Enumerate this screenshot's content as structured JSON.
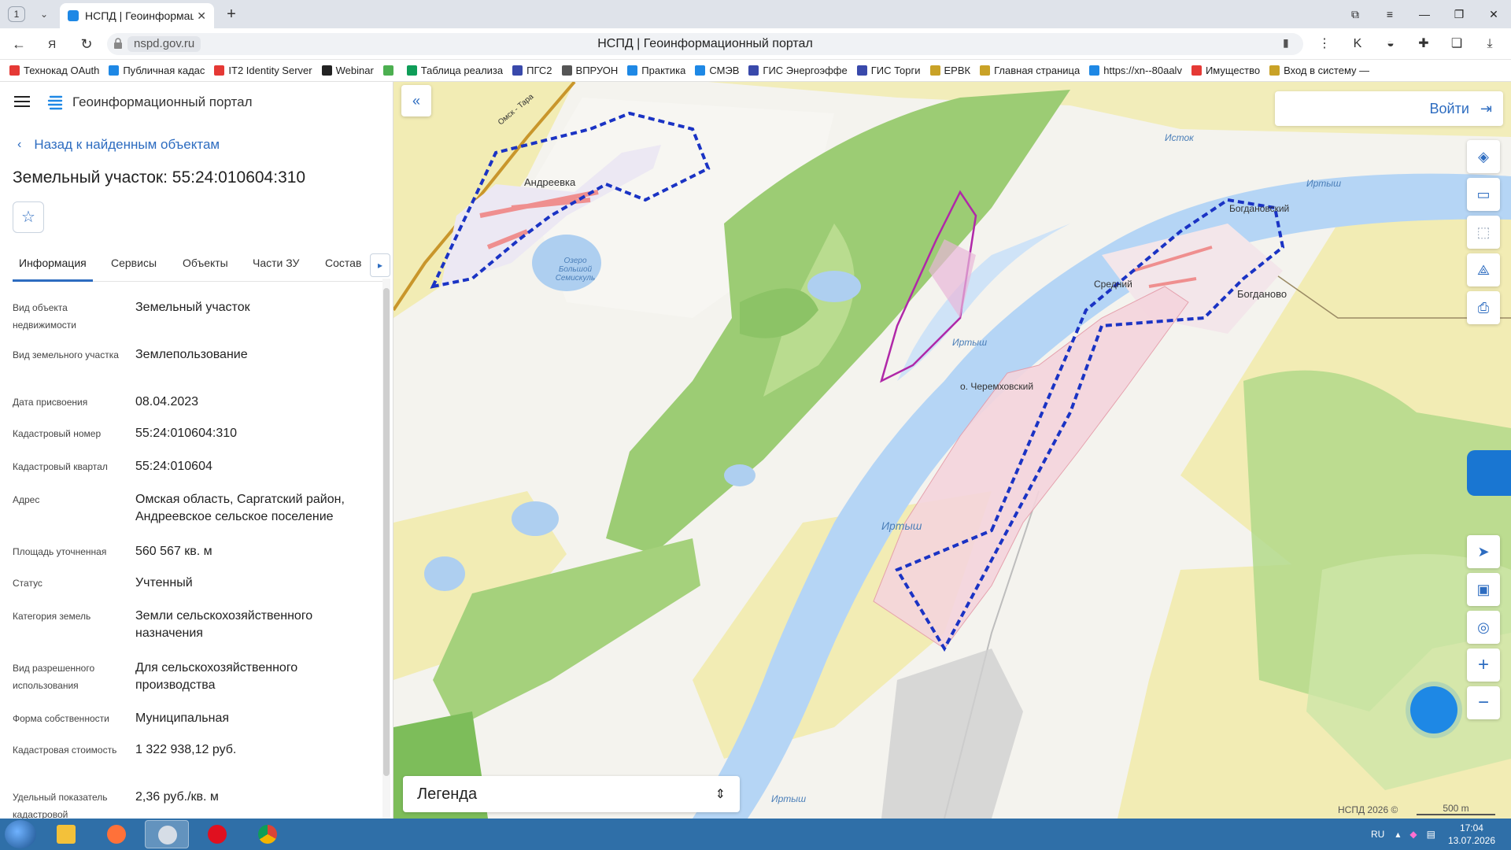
{
  "browser": {
    "tab_count": "1",
    "tab_title": "НСПД | Геоинформаци",
    "url": "nspd.gov.ru",
    "page_title": "НСПД | Геоинформационный портал"
  },
  "bookmarks": [
    {
      "label": "Технокад OAuth",
      "color": "#e53935"
    },
    {
      "label": "Публичная кадас",
      "color": "#1e88e5"
    },
    {
      "label": "IT2 Identity Server",
      "color": "#e53935"
    },
    {
      "label": "Webinar",
      "color": "#222222"
    },
    {
      "label": "",
      "color": "#4caf50"
    },
    {
      "label": "Таблица реализа",
      "color": "#0f9d58"
    },
    {
      "label": "ПГС2",
      "color": "#3949ab"
    },
    {
      "label": "ВПРУОН",
      "color": "#555555"
    },
    {
      "label": "Практика",
      "color": "#1e88e5"
    },
    {
      "label": "СМЭВ",
      "color": "#1e88e5"
    },
    {
      "label": "ГИС Энергоэффе",
      "color": "#3949ab"
    },
    {
      "label": "ГИС Торги",
      "color": "#3949ab"
    },
    {
      "label": "ЕРВК",
      "color": "#c9a227"
    },
    {
      "label": "Главная страница",
      "color": "#c9a227"
    },
    {
      "label": "https://xn--80aalv",
      "color": "#1e88e5"
    },
    {
      "label": "Имущество",
      "color": "#e53935"
    },
    {
      "label": "Вход в систему —",
      "color": "#c9a227"
    }
  ],
  "panel": {
    "portal_title": "Геоинформационный портал",
    "back_label": "Назад к найденным объектам",
    "object_title": "Земельный участок: 55:24:010604:310",
    "tabs": [
      "Информация",
      "Сервисы",
      "Объекты",
      "Части ЗУ",
      "Состав"
    ],
    "active_tab": "Информация",
    "rows": [
      {
        "label": "Вид объекта недвижимости",
        "value": "Земельный участок"
      },
      {
        "label": "Вид земельного участка",
        "value": "Землепользование"
      },
      {
        "label": "Дата присвоения",
        "value": "08.04.2023"
      },
      {
        "label": "Кадастровый номер",
        "value": "55:24:010604:310"
      },
      {
        "label": "Кадастровый квартал",
        "value": "55:24:010604"
      },
      {
        "label": "Адрес",
        "value": "Омская область, Саргатский район, Андреевское сельское поселение"
      },
      {
        "label": "Площадь уточненная",
        "value": "560 567 кв. м"
      },
      {
        "label": "Статус",
        "value": "Учтенный"
      },
      {
        "label": "Категория земель",
        "value": "Земли сельскохозяйственного назначения"
      },
      {
        "label": "Вид разрешенного использования",
        "value": "Для сельскохозяйственного производства"
      },
      {
        "label": "Форма собственности",
        "value": "Муниципальная"
      },
      {
        "label": "Кадастровая стоимость",
        "value": "1 322 938,12 руб."
      },
      {
        "label": "Удельный показатель кадастровой",
        "value": "2,36 руб./кв. м"
      }
    ]
  },
  "map": {
    "login_label": "Войти",
    "legend_label": "Легенда",
    "copyright": "НСПД 2026 ©",
    "scale": "500 m",
    "places": {
      "andreevka": "Андреевка",
      "bogdanovo": "Богданово",
      "bogdanovsky": "Богдановский",
      "sredny": "Средний",
      "cheremkhovsky": "о. Черемховский",
      "irtysh1": "Иртыш",
      "irtysh2": "Иртыш",
      "irtysh3": "Иртыш",
      "irtysh4": "Иртыш",
      "istok": "Исток",
      "lake": "Озеро Большой Семискуль",
      "road": "Омск - Тара"
    }
  },
  "taskbar": {
    "lang": "RU",
    "time": "17:04",
    "date": "13.07.2026"
  }
}
